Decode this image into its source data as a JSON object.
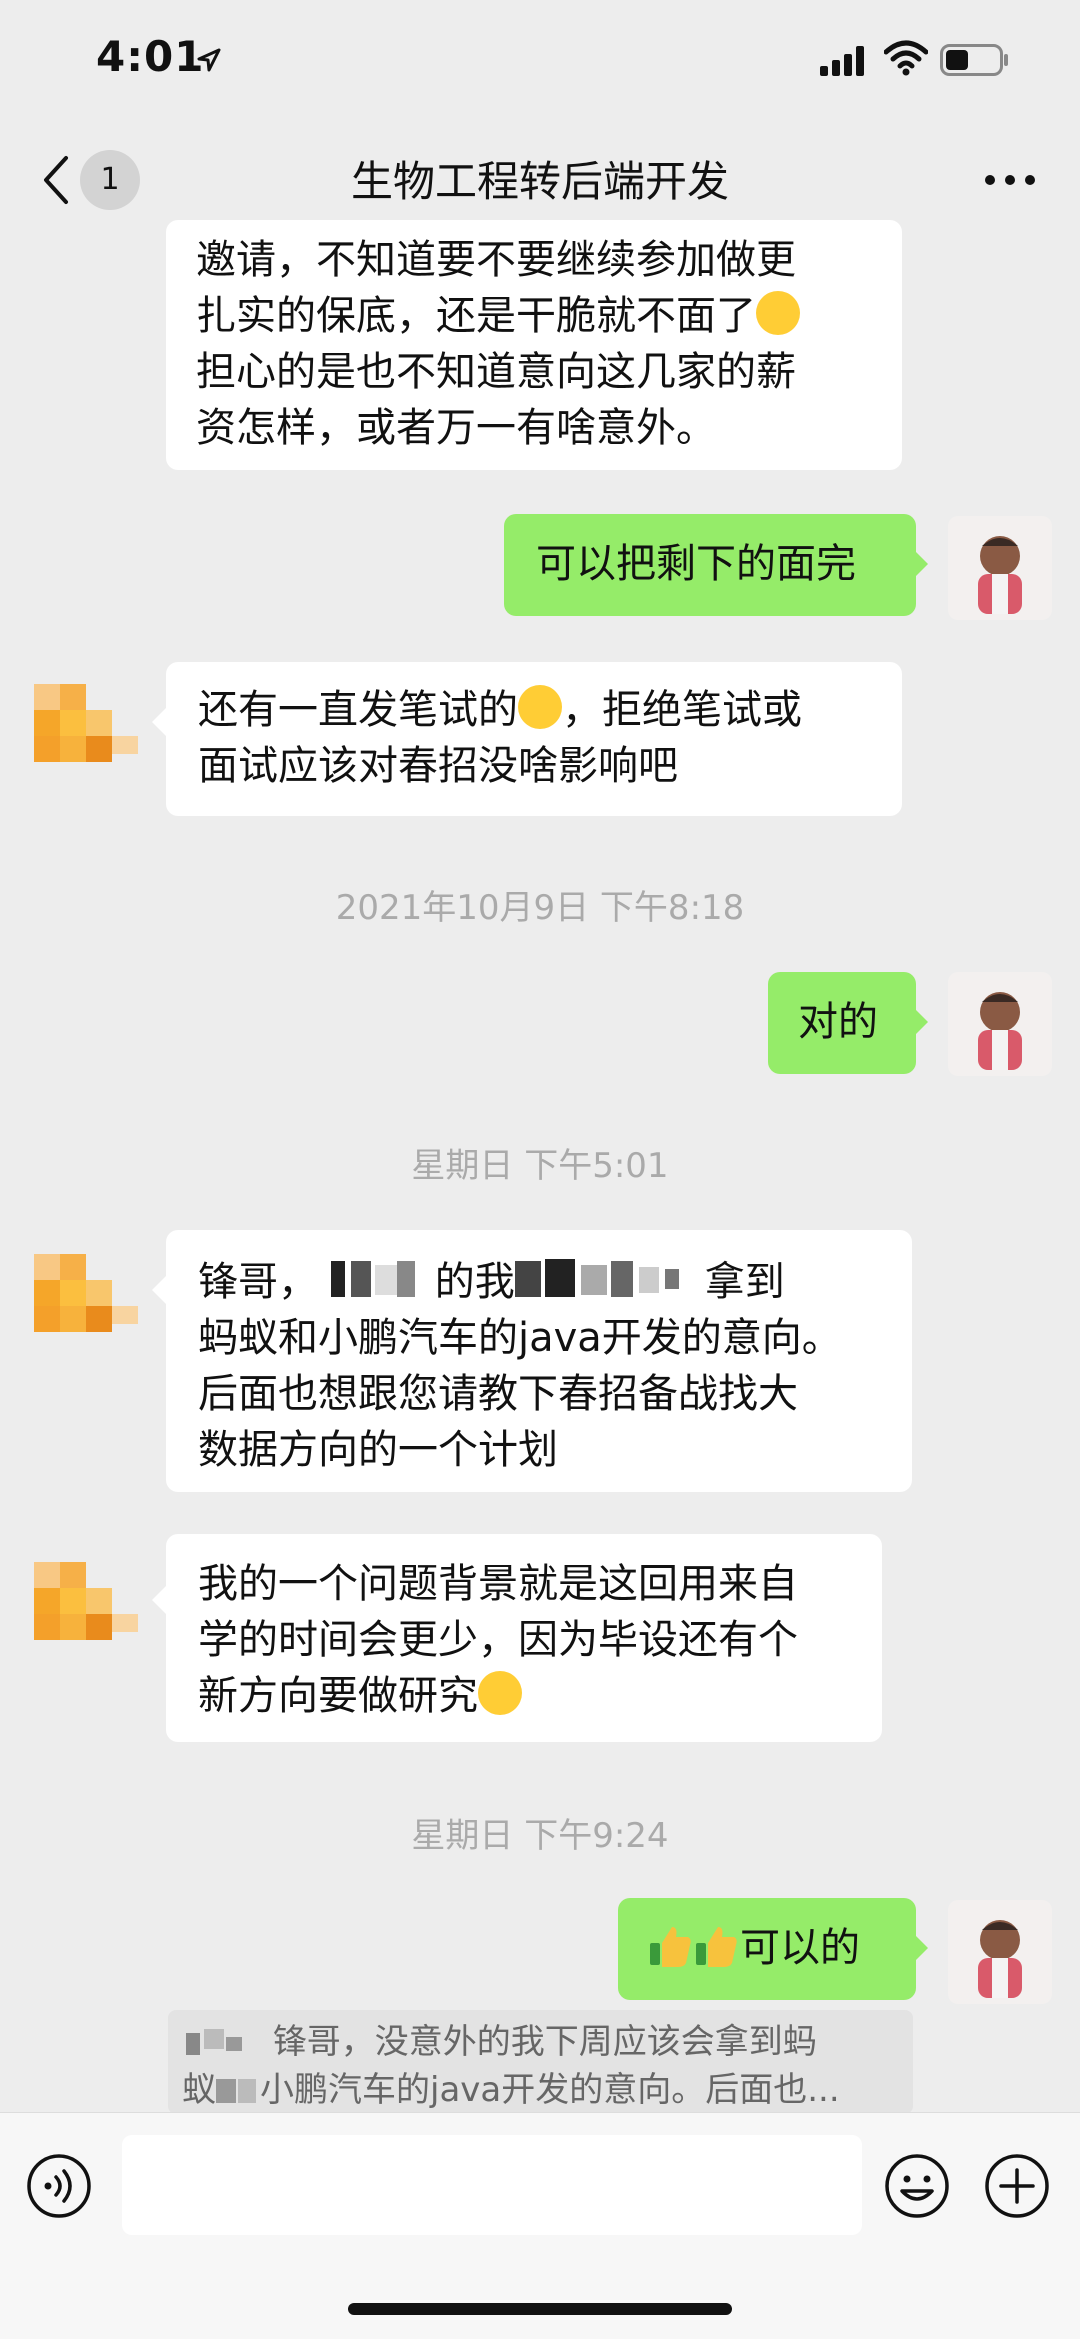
{
  "status_bar": {
    "time": "4:01"
  },
  "nav": {
    "title": "生物工程转后端开发",
    "back_badge": "1"
  },
  "messages": {
    "m1": {
      "line1": "邀请，不知道要不要继续参加做更",
      "line2": "扎实的保底，还是干脆就不面了",
      "line3": "担心的是也不知道意向这几家的薪",
      "line4": "资怎样，或者万一有啥意外。"
    },
    "m2": {
      "text": "可以把剩下的面完"
    },
    "m3": {
      "line1a": "还有一直发笔试的",
      "line1b": "，拒绝笔试或",
      "line2": "面试应该对春招没啥影响吧"
    },
    "ts1": "2021年10月9日 下午8:18",
    "m4": {
      "text": "对的"
    },
    "ts2": "星期日 下午5:01",
    "m5": {
      "line1a": "锋哥，",
      "line1b": "的我",
      "line1c": "拿到",
      "line2": "蚂蚁和小鹏汽车的java开发的意向。",
      "line3": "后面也想跟您请教下春招备战找大",
      "line4": "数据方向的一个计划"
    },
    "m6": {
      "line1": "我的一个问题背景就是这回用来自",
      "line2": "学的时间会更少，因为毕设还有个",
      "line3": "新方向要做研究"
    },
    "ts3": "星期日 下午9:24",
    "m7": {
      "text": "可以的"
    },
    "quote": {
      "line1": "锋哥，没意外的我下周应该会拿到蚂",
      "line2a": "蚁",
      "line2b": "小鹏汽车的java开发的意向。后面也..."
    }
  },
  "colors": {
    "background": "#ededed",
    "incoming": "#ffffff",
    "outgoing": "#95ec69",
    "timestamp": "#aaaaaa"
  },
  "icons": [
    "location-arrow-icon",
    "signal-icon",
    "wifi-icon",
    "battery-icon",
    "chevron-left-icon",
    "more-icon",
    "voice-icon",
    "emoji-icon",
    "plus-icon"
  ]
}
